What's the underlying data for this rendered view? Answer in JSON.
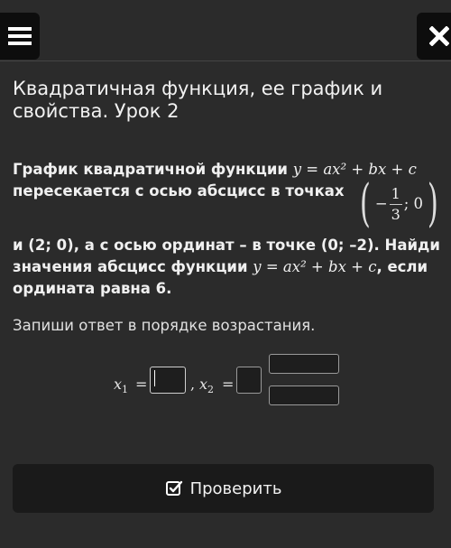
{
  "header": {
    "menu_icon": "hamburger-menu-icon",
    "close_icon": "close-icon",
    "title": "Квадратичная функция, ее график и свойства. Урок 2"
  },
  "problem": {
    "l1_text": "График квадратичной функции ",
    "l1_math": "y = ax² + bx + c",
    "l2_text": "пересекается с осью абсцисс в точках",
    "point_minus": "−",
    "point_num": "1",
    "point_den": "3",
    "point_rest": "; 0",
    "l3_text": "и (2; 0), а с осью ординат – в точке (0; –2). Найди",
    "l4_text": "значения абсцисс функции ",
    "l4_math": "y = ax² + bx + c",
    "l4_tail": ", если",
    "l5_text": "ордината равна 6."
  },
  "instruction": "Запиши ответ в порядке возрастания.",
  "answer": {
    "x1_label": "x",
    "x1_sub": "1",
    "eq": "=",
    "sep": ",",
    "x2_label": "x",
    "x2_sub": "2"
  },
  "check_button": {
    "label": "Проверить",
    "icon": "checkbox-check-icon"
  }
}
